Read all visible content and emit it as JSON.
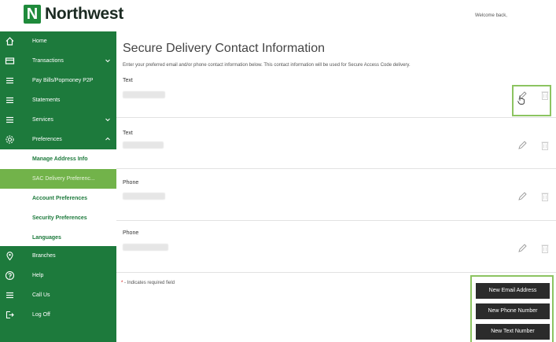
{
  "header": {
    "brand_letter": "N",
    "brand_name": "Northwest",
    "welcome": "Welcome back,"
  },
  "sidebar": {
    "items": [
      {
        "label": "Home",
        "icon": "home-icon"
      },
      {
        "label": "Transactions",
        "icon": "card-icon",
        "chevron": "down"
      },
      {
        "label": "Pay Bills/Popmoney P2P",
        "icon": "menu-icon"
      },
      {
        "label": "Statements",
        "icon": "menu-icon"
      },
      {
        "label": "Services",
        "icon": "menu-icon",
        "chevron": "down"
      },
      {
        "label": "Preferences",
        "icon": "gear-icon",
        "chevron": "up"
      }
    ],
    "sub_items": [
      {
        "label": "Manage Address Info"
      },
      {
        "label": "SAC Delivery Preferenc...",
        "active": true
      },
      {
        "label": "Account Preferences"
      },
      {
        "label": "Security Preferences"
      },
      {
        "label": "Languages"
      }
    ],
    "bottom_items": [
      {
        "label": "Branches",
        "icon": "location-icon"
      },
      {
        "label": "Help",
        "icon": "help-icon"
      },
      {
        "label": "Call Us",
        "icon": "menu-icon"
      },
      {
        "label": "Log Off",
        "icon": "logout-icon"
      }
    ]
  },
  "main": {
    "title": "Secure Delivery Contact Information",
    "instructions": "Enter your preferred email and/or phone contact information below. This contact information will be used for Secure Access Code delivery.",
    "contacts": [
      {
        "type": "Text"
      },
      {
        "type": "Text"
      },
      {
        "type": "Phone"
      },
      {
        "type": "Phone"
      }
    ],
    "required_star": "*",
    "required_note": " - Indicates required field",
    "buttons": {
      "new_email": "New Email Address",
      "new_phone": "New Phone Number",
      "new_text": "New Text Number"
    }
  },
  "colors": {
    "brand_green": "#1d7a3c",
    "active_green": "#72b34a",
    "highlight": "#8cc461",
    "button_dark": "#2b2b2b"
  }
}
